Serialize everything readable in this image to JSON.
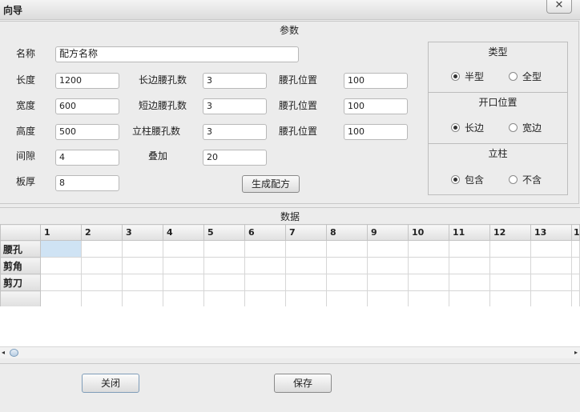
{
  "window": {
    "title": "向导",
    "close_glyph": "✕"
  },
  "params": {
    "title": "参数",
    "name_label": "名称",
    "name_value": "配方名称",
    "length_label": "长度",
    "length_value": "1200",
    "width_label": "宽度",
    "width_value": "600",
    "height_label": "高度",
    "height_value": "500",
    "gap_label": "间隙",
    "gap_value": "4",
    "thickness_label": "板厚",
    "thickness_value": "8",
    "long_side_holes_label": "长边腰孔数",
    "long_side_holes_value": "3",
    "short_side_holes_label": "短边腰孔数",
    "short_side_holes_value": "3",
    "column_holes_label": "立柱腰孔数",
    "column_holes_value": "3",
    "overlap_label": "叠加",
    "overlap_value": "20",
    "hole_pos1_label": "腰孔位置",
    "hole_pos1_value": "100",
    "hole_pos2_label": "腰孔位置",
    "hole_pos2_value": "100",
    "hole_pos3_label": "腰孔位置",
    "hole_pos3_value": "100",
    "generate_button": "生成配方"
  },
  "type_group": {
    "title": "类型",
    "option1": "半型",
    "option2": "全型",
    "selected": "半型"
  },
  "opening_group": {
    "title": "开口位置",
    "option1": "长边",
    "option2": "宽边",
    "selected": "长边"
  },
  "column_group": {
    "title": "立柱",
    "option1": "包含",
    "option2": "不含",
    "selected": "包含"
  },
  "data_section": {
    "title": "数据",
    "columns": [
      "1",
      "2",
      "3",
      "4",
      "5",
      "6",
      "7",
      "8",
      "9",
      "10",
      "11",
      "12",
      "13",
      "1"
    ],
    "row_labels": [
      "腰孔",
      "剪角",
      "剪刀",
      ""
    ]
  },
  "footer": {
    "close_button": "关闭",
    "save_button": "保存"
  },
  "icons": {
    "scroll_left": "◂",
    "scroll_right": "▸"
  }
}
